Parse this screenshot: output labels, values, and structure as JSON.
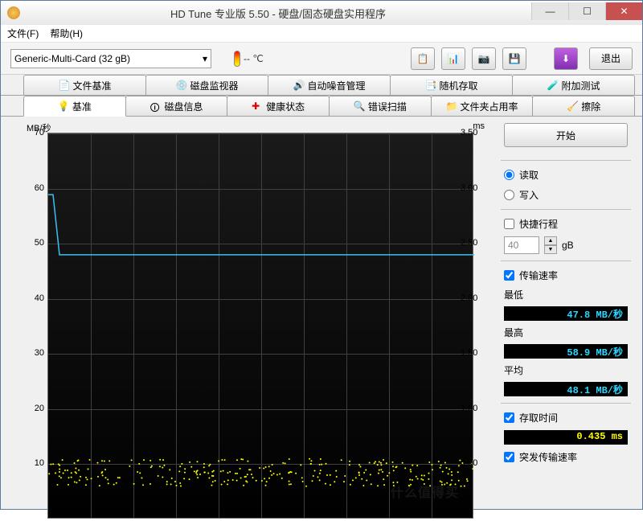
{
  "window": {
    "title": "HD Tune 专业版 5.50 - 硬盘/固态硬盘实用程序"
  },
  "menu": {
    "file": "文件(F)",
    "help": "帮助(H)"
  },
  "toolbar": {
    "drive": "Generic-Multi-Card (32 gB)",
    "temp": "-- ℃",
    "exit": "退出"
  },
  "tabs_top": [
    {
      "label": "文件基准",
      "icon": "file-bench"
    },
    {
      "label": "磁盘监视器",
      "icon": "monitor"
    },
    {
      "label": "自动噪音管理",
      "icon": "noise"
    },
    {
      "label": "随机存取",
      "icon": "random"
    },
    {
      "label": "附加测试",
      "icon": "extra"
    }
  ],
  "tabs_bottom": [
    {
      "label": "基准",
      "icon": "bench",
      "active": true
    },
    {
      "label": "磁盘信息",
      "icon": "info"
    },
    {
      "label": "健康状态",
      "icon": "health"
    },
    {
      "label": "错误扫描",
      "icon": "error"
    },
    {
      "label": "文件夹占用率",
      "icon": "folder"
    },
    {
      "label": "擦除",
      "icon": "erase"
    }
  ],
  "chart_data": {
    "type": "line",
    "ylabel_left": "MB/秒",
    "ylabel_right": "ms",
    "y_left_ticks": [
      70,
      60,
      50,
      40,
      30,
      20,
      10
    ],
    "y_right_ticks": [
      3.5,
      3.0,
      2.5,
      2.0,
      1.5,
      1.0,
      0.5
    ],
    "y_left_range": [
      0,
      70
    ],
    "y_right_range": [
      0,
      3.5
    ],
    "series": [
      {
        "name": "传输速率",
        "axis": "left",
        "color": "#3cc0f0",
        "summary": {
          "start": 58.9,
          "steady": 48.0
        }
      },
      {
        "name": "存取时间",
        "axis": "right",
        "color": "#ffff00",
        "summary": {
          "avg_ms": 0.435,
          "band_ms": [
            0.3,
            0.55
          ]
        }
      }
    ]
  },
  "panel": {
    "start": "开始",
    "read": "读取",
    "write": "写入",
    "quick": "快捷行程",
    "size_val": "40",
    "size_unit": "gB",
    "transfer": "传输速率",
    "min_label": "最低",
    "min_val": "47.8 MB/秒",
    "max_label": "最高",
    "max_val": "58.9 MB/秒",
    "avg_label": "平均",
    "avg_val": "48.1 MB/秒",
    "access_label": "存取时间",
    "access_val": "0.435 ms",
    "burst": "突发传输速率"
  },
  "watermark": "什么值得买"
}
